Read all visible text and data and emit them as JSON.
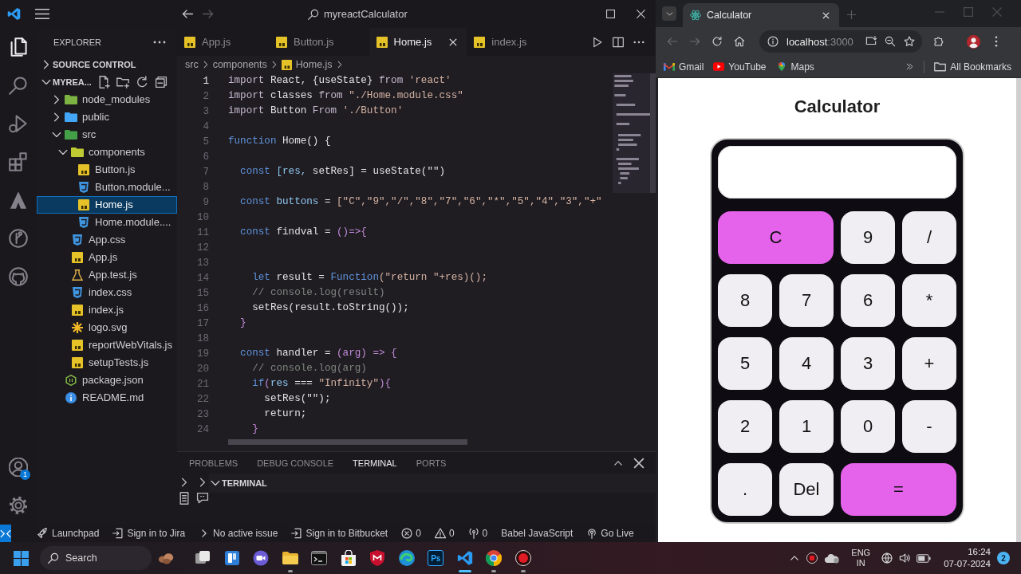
{
  "vscode": {
    "title_bar": {
      "search": "myreactCalculator"
    },
    "activity_bar": {
      "items": [
        {
          "kind": "files",
          "selected": true
        },
        {
          "kind": "search",
          "selected": false
        },
        {
          "kind": "debug",
          "selected": false
        },
        {
          "kind": "extensions",
          "selected": false
        },
        {
          "kind": "peak",
          "selected": false
        },
        {
          "kind": "graph",
          "selected": false
        },
        {
          "kind": "cat",
          "selected": false
        }
      ],
      "account_badge": "1"
    },
    "explorer": {
      "title": "EXPLORER",
      "sections": [
        {
          "label": "SOURCE CONTROL",
          "expanded": false
        },
        {
          "label": "MYREA...",
          "expanded": true,
          "tree": [
            {
              "label": "node_modules",
              "kind": "folder",
              "color": "#7cb342",
              "expanded": false,
              "selected": false
            },
            {
              "label": "public",
              "kind": "folder",
              "color": "#42a5f5",
              "expanded": false,
              "selected": false
            },
            {
              "label": "src",
              "kind": "folder",
              "color": "#43a047",
              "expanded": true,
              "selected": false,
              "children": [
                {
                  "label": "components",
                  "kind": "folder",
                  "color": "#c0ca33",
                  "expanded": true,
                  "selected": false,
                  "children": [
                    {
                      "label": "Button.js",
                      "kind": "js",
                      "selected": false
                    },
                    {
                      "label": "Button.module...",
                      "kind": "css",
                      "selected": false
                    },
                    {
                      "label": "Home.js",
                      "kind": "js",
                      "selected": true
                    },
                    {
                      "label": "Home.module....",
                      "kind": "css",
                      "selected": false
                    }
                  ]
                },
                {
                  "label": "App.css",
                  "kind": "css",
                  "selected": false
                },
                {
                  "label": "App.js",
                  "kind": "js",
                  "selected": false
                },
                {
                  "label": "App.test.js",
                  "kind": "test",
                  "selected": false
                },
                {
                  "label": "index.css",
                  "kind": "css",
                  "selected": false
                },
                {
                  "label": "index.js",
                  "kind": "js",
                  "selected": false
                },
                {
                  "label": "logo.svg",
                  "kind": "svg",
                  "selected": false
                },
                {
                  "label": "reportWebVitals.js",
                  "kind": "js",
                  "selected": false
                },
                {
                  "label": "setupTests.js",
                  "kind": "js",
                  "selected": false
                }
              ]
            },
            {
              "label": "package.json",
              "kind": "json",
              "selected": false
            },
            {
              "label": "README.md",
              "kind": "info",
              "selected": false
            }
          ]
        }
      ]
    },
    "tabs": [
      {
        "label": "App.js",
        "selected": false
      },
      {
        "label": "Button.js",
        "selected": false
      },
      {
        "label": "Home.js",
        "selected": true
      },
      {
        "label": "index.js",
        "selected": false
      }
    ],
    "breadcrumb": [
      {
        "label": "src",
        "kind": "folder"
      },
      {
        "label": "components",
        "kind": "folder"
      },
      {
        "label": "Home.js",
        "kind": "js"
      }
    ],
    "code_lines": [
      {
        "number": "1",
        "current": true,
        "tokens": [
          {
            "kind": "keyword",
            "text": "import"
          },
          {
            "kind": "plain",
            "text": " React, {useState} "
          },
          {
            "kind": "keyword",
            "text": "from"
          },
          {
            "kind": "string",
            "text": " 'react'"
          }
        ]
      },
      {
        "number": "2",
        "current": false,
        "tokens": [
          {
            "kind": "keyword",
            "text": "import"
          },
          {
            "kind": "plain",
            "text": " classes "
          },
          {
            "kind": "keyword",
            "text": "from"
          },
          {
            "kind": "string",
            "text": " \"./Home.module.css\""
          }
        ]
      },
      {
        "number": "3",
        "current": false,
        "tokens": [
          {
            "kind": "keyword",
            "text": "import"
          },
          {
            "kind": "plain",
            "text": " Button "
          },
          {
            "kind": "keyword",
            "text": "From"
          },
          {
            "kind": "string",
            "text": " './Button'"
          }
        ]
      },
      {
        "number": "4",
        "current": false
      },
      {
        "number": "5",
        "current": false,
        "tokens": [
          {
            "kind": "storage",
            "text": "function"
          },
          {
            "kind": "plain",
            "text": " Home() {"
          }
        ]
      },
      {
        "number": "6",
        "current": false
      },
      {
        "number": "7",
        "current": false,
        "tokens": [
          {
            "kind": "storage",
            "text": "  const"
          },
          {
            "kind": "variable",
            "text": " [res,"
          },
          {
            "kind": "plain",
            "text": " setRes] = useState(\"\")"
          }
        ]
      },
      {
        "number": "8",
        "current": false
      },
      {
        "number": "9",
        "current": false,
        "tokens": [
          {
            "kind": "storage",
            "text": "  const"
          },
          {
            "kind": "variable",
            "text": " buttons"
          },
          {
            "kind": "plain",
            "text": " = "
          },
          {
            "kind": "string",
            "text": "[\"C\",\"9\",\"/\",\"8\",\"7\",\"6\",\"*\",\"5\",\"4\",\"3\",\"+\""
          }
        ]
      },
      {
        "number": "10",
        "current": false
      },
      {
        "number": "11",
        "current": false,
        "tokens": [
          {
            "kind": "storage",
            "text": "  const"
          },
          {
            "kind": "plain",
            "text": " findval = "
          },
          {
            "kind": "punct",
            "text": "()=>{"
          }
        ]
      },
      {
        "number": "12",
        "current": false
      },
      {
        "number": "13",
        "current": false
      },
      {
        "number": "14",
        "current": false,
        "tokens": [
          {
            "kind": "storage",
            "text": "    let"
          },
          {
            "kind": "plain",
            "text": " result = "
          },
          {
            "kind": "storage",
            "text": "Function"
          },
          {
            "kind": "string",
            "text": "(\"return \"+res)();"
          }
        ]
      },
      {
        "number": "15",
        "current": false,
        "tokens": [
          {
            "kind": "comment",
            "text": "    // console.log(result)"
          }
        ]
      },
      {
        "number": "16",
        "current": false,
        "tokens": [
          {
            "kind": "plain",
            "text": "    setRes(result.toString());"
          }
        ]
      },
      {
        "number": "17",
        "current": false,
        "tokens": [
          {
            "kind": "punct",
            "text": "  }"
          }
        ]
      },
      {
        "number": "18",
        "current": false
      },
      {
        "number": "19",
        "current": false,
        "tokens": [
          {
            "kind": "storage",
            "text": "  const"
          },
          {
            "kind": "plain",
            "text": " handler = "
          },
          {
            "kind": "punct",
            "text": "(arg) => {"
          }
        ]
      },
      {
        "number": "20",
        "current": false,
        "tokens": [
          {
            "kind": "comment",
            "text": "    // console.log(arg)"
          }
        ]
      },
      {
        "number": "21",
        "current": false,
        "tokens": [
          {
            "kind": "storage",
            "text": "    if"
          },
          {
            "kind": "punct",
            "text": "("
          },
          {
            "kind": "variable",
            "text": "res"
          },
          {
            "kind": "plain",
            "text": " === "
          },
          {
            "kind": "string",
            "text": "\"Infinity\""
          },
          {
            "kind": "punct",
            "text": "){"
          }
        ]
      },
      {
        "number": "22",
        "current": false,
        "tokens": [
          {
            "kind": "plain",
            "text": "      setRes(\"\");"
          }
        ]
      },
      {
        "number": "23",
        "current": false,
        "tokens": [
          {
            "kind": "plain",
            "text": "      return;"
          }
        ]
      },
      {
        "number": "24",
        "current": false,
        "tokens": [
          {
            "kind": "punct",
            "text": "    }"
          }
        ]
      }
    ],
    "panel": {
      "tabs": [
        {
          "label": "PROBLEMS",
          "selected": false
        },
        {
          "label": "DEBUG CONSOLE",
          "selected": false
        },
        {
          "label": "TERMINAL",
          "selected": true
        },
        {
          "label": "PORTS",
          "selected": false
        }
      ],
      "section": {
        "label": "TERMINAL",
        "expanded": true
      }
    },
    "status_bar": [
      {
        "kind": "launchpad",
        "label": "Launchpad"
      },
      {
        "kind": "jira",
        "label": "Sign in to Jira"
      },
      {
        "kind": "issue",
        "label": "No active issue"
      },
      {
        "kind": "bitbucket",
        "label": "Sign in to Bitbucket"
      },
      {
        "kind": "errors",
        "label": "0"
      },
      {
        "kind": "warnings",
        "label": "0"
      },
      {
        "kind": "ports",
        "label": "0"
      },
      {
        "kind": "language",
        "label": "Babel JavaScript"
      },
      {
        "kind": "live",
        "label": "Go Live"
      }
    ]
  },
  "browser": {
    "tabs": [
      {
        "title": "Calculator",
        "selected": true
      }
    ],
    "address": {
      "host": "localhost",
      "port": ":3000"
    },
    "bookmarks": [
      {
        "label": "Gmail",
        "kind": "mail"
      },
      {
        "label": "YouTube",
        "kind": "video"
      },
      {
        "label": "Maps",
        "kind": "map"
      }
    ],
    "all_bookmarks": "All Bookmarks",
    "page": {
      "title": "Calculator",
      "keys": [
        {
          "label": "C",
          "kind": "action"
        },
        {
          "label": "9",
          "kind": "key"
        },
        {
          "label": "/",
          "kind": "key"
        },
        {
          "label": "8",
          "kind": "key"
        },
        {
          "label": "7",
          "kind": "key"
        },
        {
          "label": "6",
          "kind": "key"
        },
        {
          "label": "*",
          "kind": "key"
        },
        {
          "label": "5",
          "kind": "key"
        },
        {
          "label": "4",
          "kind": "key"
        },
        {
          "label": "3",
          "kind": "key"
        },
        {
          "label": "+",
          "kind": "key"
        },
        {
          "label": "2",
          "kind": "key"
        },
        {
          "label": "1",
          "kind": "key"
        },
        {
          "label": "0",
          "kind": "key"
        },
        {
          "label": "-",
          "kind": "key"
        },
        {
          "label": ".",
          "kind": "key"
        },
        {
          "label": "Del",
          "kind": "key"
        },
        {
          "label": "=",
          "kind": "action"
        }
      ]
    }
  },
  "taskbar": {
    "search": "Search",
    "apps": [
      {
        "kind": "widget",
        "running": false,
        "selected": false
      },
      {
        "kind": "taskview",
        "running": false,
        "selected": false
      },
      {
        "kind": "board",
        "running": false,
        "selected": false
      },
      {
        "kind": "meet",
        "running": false,
        "selected": false
      },
      {
        "kind": "folder",
        "running": true,
        "selected": false
      },
      {
        "kind": "terminal",
        "running": false,
        "selected": false
      },
      {
        "kind": "store",
        "running": false,
        "selected": false
      },
      {
        "kind": "shield",
        "running": false,
        "selected": false
      },
      {
        "kind": "swirl",
        "running": false,
        "selected": false
      },
      {
        "kind": "tile",
        "label": "Ps",
        "running": false,
        "selected": false
      },
      {
        "kind": "editor",
        "running": true,
        "selected": true
      },
      {
        "kind": "browser",
        "running": true,
        "selected": false
      },
      {
        "kind": "record",
        "running": true,
        "selected": false
      }
    ],
    "tray": {
      "language": "ENG",
      "region": "IN",
      "time": "16:24",
      "date": "07-07-2024",
      "notifications": "2"
    }
  }
}
